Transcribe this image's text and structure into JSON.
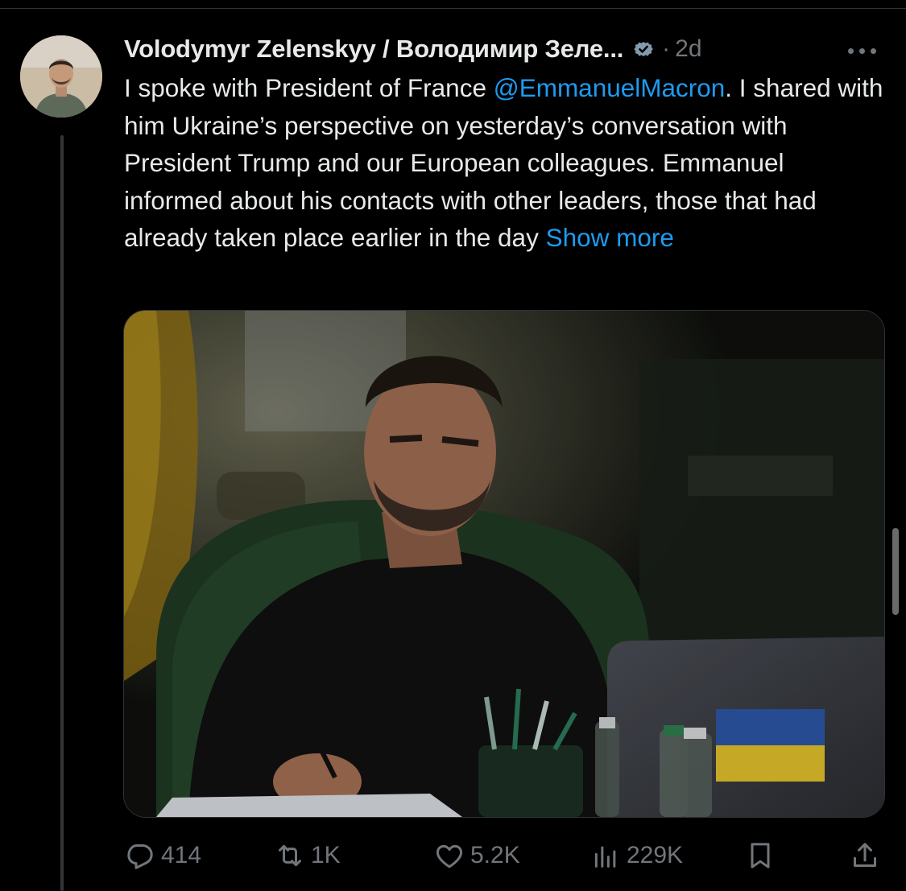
{
  "tweet": {
    "author": {
      "display_name": "Volodymyr Zelenskyy / Володимир Зеле...",
      "verified": true,
      "avatar_icon": "profile-photo"
    },
    "dot": "·",
    "time": "2d",
    "text": {
      "part1": "I spoke with President of France ",
      "mention": "@EmmanuelMacron",
      "part2": ". I shared with him Ukraine’s perspective on yesterday’s conversation with President Trump and our European colleagues. Emmanuel informed about his contacts with other leaders, those that had already taken place earlier in the day ",
      "show_more": "Show more"
    },
    "media": {
      "type": "photo",
      "description_icon": "photo"
    },
    "actions": {
      "replies": "414",
      "reposts": "1K",
      "likes": "5.2K",
      "views": "229K"
    }
  },
  "colors": {
    "background": "#000000",
    "text": "#e7e9ea",
    "secondary": "#71767b",
    "accent": "#1d9bf0",
    "verified_badge": "#829aab"
  }
}
